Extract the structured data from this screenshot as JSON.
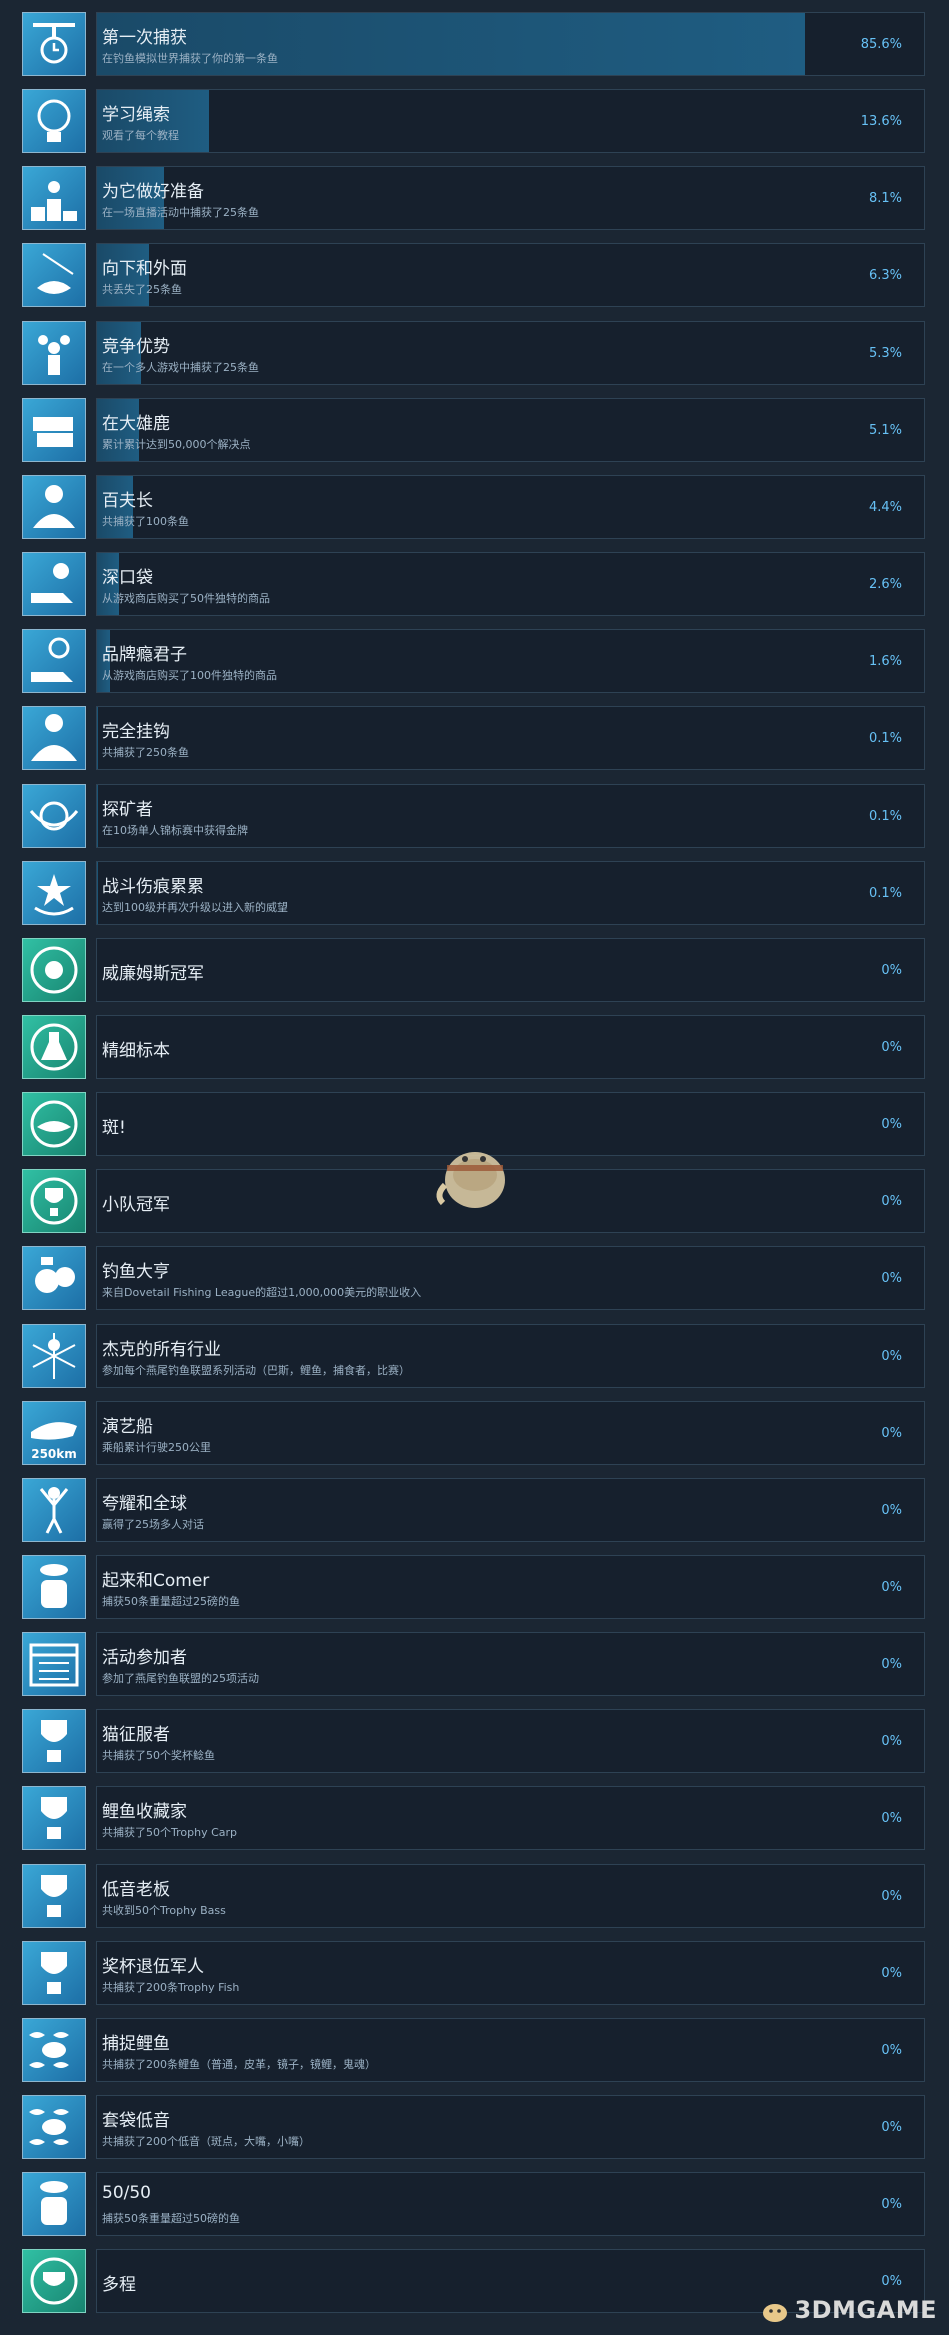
{
  "achievements": [
    {
      "title": "第一次捕获",
      "desc": "在钓鱼模拟世界捕获了你的第一条鱼",
      "percent": "85.6%",
      "fill": 85.6,
      "icon": "fishing-rod-icon",
      "theme": "blue"
    },
    {
      "title": "学习绳索",
      "desc": "观看了每个教程",
      "percent": "13.6%",
      "fill": 13.6,
      "icon": "lightbulb-icon",
      "theme": "blue"
    },
    {
      "title": "为它做好准备",
      "desc": "在一场直播活动中捕获了25条鱼",
      "percent": "8.1%",
      "fill": 8.1,
      "icon": "podium-icon",
      "theme": "blue"
    },
    {
      "title": "向下和外面",
      "desc": "共丢失了25条鱼",
      "percent": "6.3%",
      "fill": 6.3,
      "icon": "fish-hook-icon",
      "theme": "blue"
    },
    {
      "title": "竞争优势",
      "desc": "在一个多人游戏中捕获了25条鱼",
      "percent": "5.3%",
      "fill": 5.3,
      "icon": "crowd-icon",
      "theme": "blue"
    },
    {
      "title": "在大雄鹿",
      "desc": "累计累计达到50,000个解决点",
      "percent": "5.1%",
      "fill": 5.1,
      "icon": "cash-stack-icon",
      "theme": "blue"
    },
    {
      "title": "百夫长",
      "desc": "共捕获了100条鱼",
      "percent": "4.4%",
      "fill": 4.4,
      "icon": "fish-pile-100-icon",
      "theme": "blue"
    },
    {
      "title": "深口袋",
      "desc": "从游戏商店购买了50件独特的商品",
      "percent": "2.6%",
      "fill": 2.6,
      "icon": "money-hand-icon",
      "theme": "blue"
    },
    {
      "title": "品牌瘾君子",
      "desc": "从游戏商店购买了100件独特的商品",
      "percent": "1.6%",
      "fill": 1.6,
      "icon": "shopping-hand-icon",
      "theme": "blue"
    },
    {
      "title": "完全挂钩",
      "desc": "共捕获了250条鱼",
      "percent": "0.1%",
      "fill": 0.1,
      "icon": "fish-pile-250-icon",
      "theme": "blue"
    },
    {
      "title": "探矿者",
      "desc": "在10场单人锦标赛中获得金牌",
      "percent": "0.1%",
      "fill": 0.1,
      "icon": "medal-icon",
      "theme": "blue"
    },
    {
      "title": "战斗伤痕累累",
      "desc": "达到100级并再次升级以进入新的威望",
      "percent": "0.1%",
      "fill": 0.1,
      "icon": "star-wreath-icon",
      "theme": "blue"
    },
    {
      "title": "威廉姆斯冠军",
      "desc": "",
      "percent": "0%",
      "fill": 0,
      "icon": "trophy-badge-icon",
      "theme": "teal"
    },
    {
      "title": "精细标本",
      "desc": "",
      "percent": "0%",
      "fill": 0,
      "icon": "flask-icon",
      "theme": "teal"
    },
    {
      "title": "斑!",
      "desc": "",
      "percent": "0%",
      "fill": 0,
      "icon": "fish-badge-icon",
      "theme": "teal"
    },
    {
      "title": "小队冠军",
      "desc": "",
      "percent": "0%",
      "fill": 0,
      "icon": "team-trophy-icon",
      "theme": "teal"
    },
    {
      "title": "钓鱼大亨",
      "desc": "来自Dovetail Fishing League的超过1,000,000美元的职业收入",
      "percent": "0%",
      "fill": 0,
      "icon": "money-bags-icon",
      "theme": "blue"
    },
    {
      "title": "杰克的所有行业",
      "desc": "参加每个燕尾钓鱼联盟系列活动（巴斯，鲤鱼，捕食者，比赛）",
      "percent": "0%",
      "fill": 0,
      "icon": "burst-figure-icon",
      "theme": "blue"
    },
    {
      "title": "演艺船",
      "desc": "乘船累计行驶250公里",
      "percent": "0%",
      "fill": 0,
      "icon": "boat-icon",
      "theme": "blue",
      "label": "250km"
    },
    {
      "title": "夸耀和全球",
      "desc": "赢得了25场多人对话",
      "percent": "0%",
      "fill": 0,
      "icon": "victory-figure-icon",
      "theme": "blue"
    },
    {
      "title": "起来和Comer",
      "desc": "捕获50条重量超过25磅的鱼",
      "percent": "0%",
      "fill": 0,
      "icon": "scale-25-50-icon",
      "theme": "blue"
    },
    {
      "title": "活动参加者",
      "desc": "参加了燕尾钓鱼联盟的25项活动",
      "percent": "0%",
      "fill": 0,
      "icon": "calendar-icon",
      "theme": "blue"
    },
    {
      "title": "猫征服者",
      "desc": "共捕获了50个奖杯鲶鱼",
      "percent": "0%",
      "fill": 0,
      "icon": "catfish-trophy-icon",
      "theme": "blue"
    },
    {
      "title": "鲤鱼收藏家",
      "desc": "共捕获了50个Trophy Carp",
      "percent": "0%",
      "fill": 0,
      "icon": "carp-trophy-icon",
      "theme": "blue"
    },
    {
      "title": "低音老板",
      "desc": "共收到50个Trophy Bass",
      "percent": "0%",
      "fill": 0,
      "icon": "bass-trophy-icon",
      "theme": "blue"
    },
    {
      "title": "奖杯退伍军人",
      "desc": "共捕获了200条Trophy Fish",
      "percent": "0%",
      "fill": 0,
      "icon": "trophy-200-icon",
      "theme": "blue"
    },
    {
      "title": "捕捉鲤鱼",
      "desc": "共捕获了200条鲤鱼（普通，皮革，镜子，镜鲤，鬼魂）",
      "percent": "0%",
      "fill": 0,
      "icon": "carp-school-icon",
      "theme": "blue"
    },
    {
      "title": "套袋低音",
      "desc": "共捕获了200个低音（斑点，大嘴，小嘴）",
      "percent": "0%",
      "fill": 0,
      "icon": "bass-school-icon",
      "theme": "blue"
    },
    {
      "title": "50/50",
      "desc": "捕获50条重量超过50磅的鱼",
      "percent": "0%",
      "fill": 0,
      "icon": "scale-50-50-icon",
      "theme": "blue"
    },
    {
      "title": "多程",
      "desc": "",
      "percent": "0%",
      "fill": 0,
      "icon": "multi-trophy-icon",
      "theme": "teal"
    }
  ],
  "watermark": "3DMGAME"
}
